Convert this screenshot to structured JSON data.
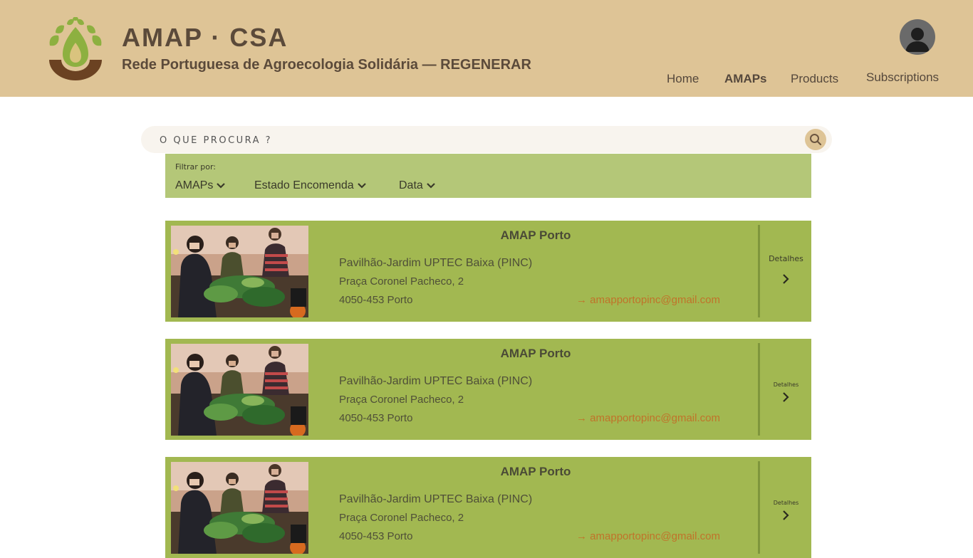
{
  "header": {
    "title": "AMAP · CSA",
    "subtitle": "Rede Portuguesa de Agroecologia Solidária — REGENERAR",
    "logo_icon": "sprout-leaf-logo",
    "avatar_icon": "user-avatar-icon"
  },
  "nav": {
    "items": [
      {
        "label": "Home"
      },
      {
        "label": "AMAPs"
      },
      {
        "label": "Products"
      },
      {
        "label": "Subscriptions"
      }
    ],
    "active": "AMAPs"
  },
  "search": {
    "placeholder": "O QUE PROCURA ?",
    "value": ""
  },
  "filter": {
    "label": "Filtrar por:",
    "options": [
      {
        "label": "AMAPs"
      },
      {
        "label": "Estado Encomenda"
      },
      {
        "label": "Data"
      }
    ]
  },
  "cards": [
    {
      "title": "AMAP Porto",
      "venue": "Pavilhão-Jardim UPTEC Baixa (PINC)",
      "street": "Praça Coronel Pacheco, 2",
      "city": "4050-453 Porto",
      "email": "→ amapportopinc@gmail.com",
      "details_label": "Detalhes"
    },
    {
      "title": "AMAP Porto",
      "venue": "Pavilhão-Jardim UPTEC Baixa (PINC)",
      "street": "Praça Coronel Pacheco, 2",
      "city": "4050-453 Porto",
      "email": "→ amapportopinc@gmail.com",
      "details_label": "Detalhes"
    },
    {
      "title": "AMAP Porto",
      "venue": "Pavilhão-Jardim UPTEC Baixa (PINC)",
      "street": "Praça Coronel Pacheco, 2",
      "city": "4050-453 Porto",
      "email": "→ amapportopinc@gmail.com",
      "details_label": "Detalhes"
    }
  ],
  "colors": {
    "header_bg": "#dec496",
    "filter_bg": "#b4c778",
    "card_bg": "#a2b851",
    "email": "#c0732a",
    "text_dark": "#5b4a3a"
  }
}
